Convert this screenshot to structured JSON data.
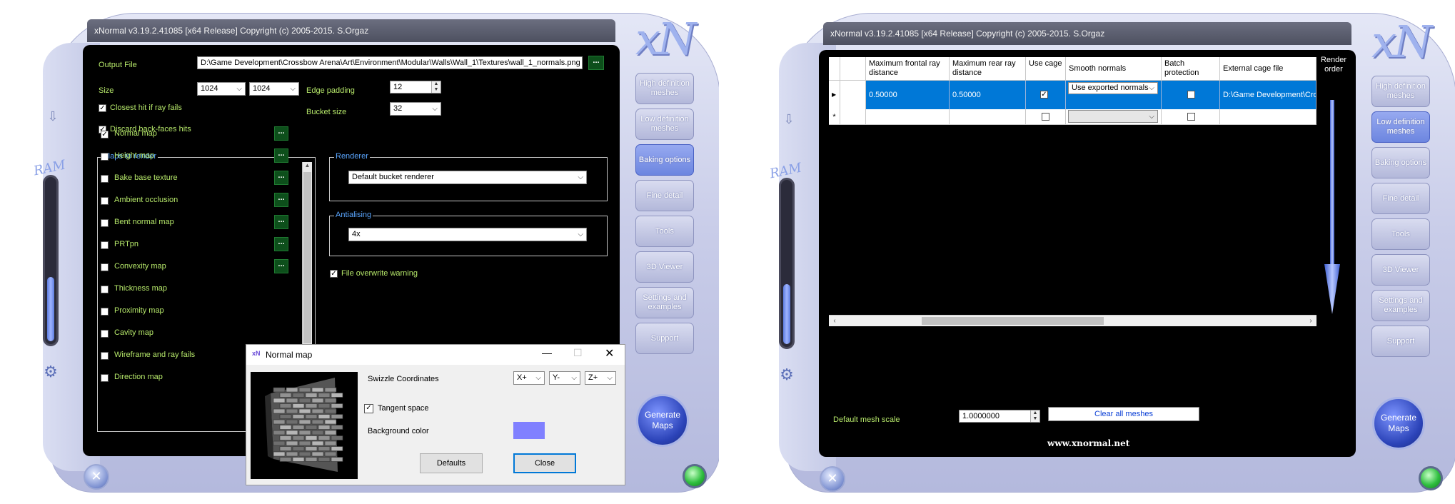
{
  "left": {
    "title": "xNormal v3.19.2.41085 [x64 Release] Copyright (c) 2005-2015. S.Orgaz",
    "logo": "xN",
    "ram_label": "RAM",
    "ram_level_percent": 40,
    "output_file": {
      "label": "Output File",
      "value": "D:\\Game Development\\Crossbow Arena\\Art\\Environment\\Modular\\Walls\\Wall_1\\Textures\\wall_1_normals.png",
      "browse": "..."
    },
    "size": {
      "label": "Size",
      "width": "1024",
      "height": "1024"
    },
    "edge_padding": {
      "label": "Edge padding",
      "value": "12"
    },
    "bucket_size": {
      "label": "Bucket size",
      "value": "32"
    },
    "closest_hit": {
      "label": "Closest hit if ray fails",
      "checked": true
    },
    "discard_backfaces": {
      "label": "Discard back-faces hits",
      "checked": true
    },
    "maps_group_label": "Maps to render",
    "maps": [
      {
        "label": "Normal map",
        "checked": true,
        "options": "..."
      },
      {
        "label": "Height map",
        "checked": false,
        "options": "..."
      },
      {
        "label": "Bake base texture",
        "checked": false,
        "options": "..."
      },
      {
        "label": "Ambient occlusion",
        "checked": false,
        "options": "..."
      },
      {
        "label": "Bent normal map",
        "checked": false,
        "options": "..."
      },
      {
        "label": "PRTpn",
        "checked": false,
        "options": "..."
      },
      {
        "label": "Convexity map",
        "checked": false,
        "options": "..."
      },
      {
        "label": "Thickness map",
        "checked": false
      },
      {
        "label": "Proximity map",
        "checked": false
      },
      {
        "label": "Cavity map",
        "checked": false
      },
      {
        "label": "Wireframe and ray fails",
        "checked": false
      },
      {
        "label": "Direction map",
        "checked": false
      }
    ],
    "renderer": {
      "label": "Renderer",
      "value": "Default bucket renderer"
    },
    "antialiasing": {
      "label": "Antialising",
      "value": "4x"
    },
    "file_overwrite": {
      "label": "File overwrite warning",
      "checked": true
    },
    "side_buttons": [
      {
        "label": "High definition meshes",
        "active": false
      },
      {
        "label": "Low definition meshes",
        "active": false
      },
      {
        "label": "Baking options",
        "active": true
      },
      {
        "label": "Fine detail",
        "active": false
      },
      {
        "label": "Tools",
        "active": false
      },
      {
        "label": "3D Viewer",
        "active": false
      },
      {
        "label": "Settings and examples",
        "active": false
      },
      {
        "label": "Support",
        "active": false
      }
    ],
    "generate_button": "Generate Maps",
    "dialog": {
      "icon": "xN",
      "title": "Normal map",
      "swizzle_label": "Swizzle Coordinates",
      "swizzle": [
        "X+",
        "Y-",
        "Z+"
      ],
      "tangent_space": {
        "label": "Tangent space",
        "checked": true
      },
      "background_label": "Background color",
      "background_color": "#8080ff",
      "defaults_button": "Defaults",
      "close_button": "Close"
    }
  },
  "right": {
    "title": "xNormal v3.19.2.41085 [x64 Release] Copyright (c) 2005-2015. S.Orgaz",
    "logo": "xN",
    "ram_label": "RAM",
    "ram_level_percent": 37,
    "grid": {
      "columns": [
        "Maximum frontal ray distance",
        "Maximum rear ray distance",
        "Use cage",
        "Smooth normals",
        "Batch protection",
        "External cage file"
      ],
      "row": {
        "frontal": "0.50000",
        "rear": "0.50000",
        "use_cage": true,
        "smooth_normals": "Use exported normals",
        "batch_protection": false,
        "cage_file": "D:\\Game Development\\Cro"
      },
      "new_row_marker": "*"
    },
    "render_order_label": "Render order",
    "default_mesh_scale": {
      "label": "Default mesh scale",
      "value": "1.0000000"
    },
    "clear_all_button": "Clear all meshes",
    "website": "www.xnormal.net",
    "side_buttons": [
      {
        "label": "High definition meshes",
        "active": false
      },
      {
        "label": "Low definition meshes",
        "active": true
      },
      {
        "label": "Baking options",
        "active": false
      },
      {
        "label": "Fine detail",
        "active": false
      },
      {
        "label": "Tools",
        "active": false
      },
      {
        "label": "3D Viewer",
        "active": false
      },
      {
        "label": "Settings and examples",
        "active": false
      },
      {
        "label": "Support",
        "active": false
      }
    ],
    "generate_button": "Generate Maps"
  },
  "colors": {
    "label_green": "#b6e86a",
    "group_blue": "#5aa6ff",
    "selected_row": "#0078d7",
    "active_side": "#7b93e6"
  }
}
